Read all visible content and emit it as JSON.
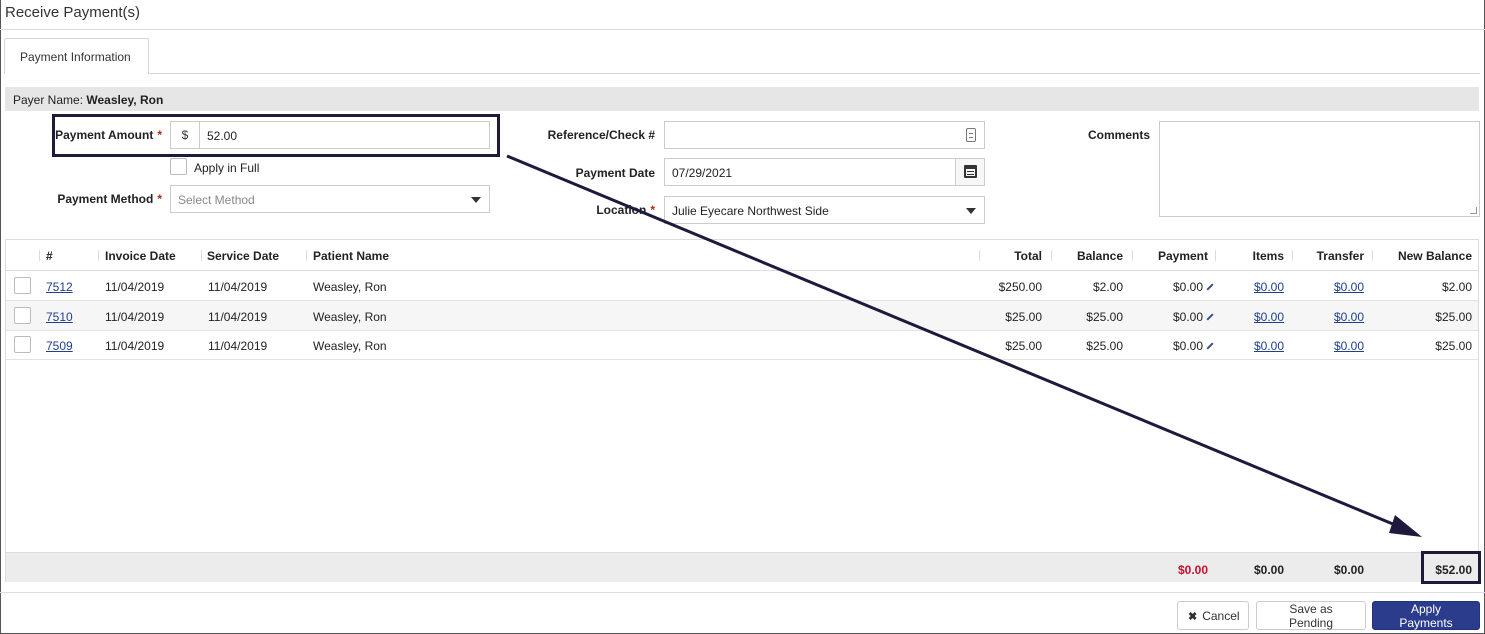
{
  "window": {
    "title": "Receive Payment(s)"
  },
  "tabs": [
    {
      "label": "Payment Information"
    }
  ],
  "payer": {
    "label": "Payer Name:",
    "name": "Weasley, Ron"
  },
  "form": {
    "payment_amount": {
      "label": "Payment Amount",
      "currency": "$",
      "value": "52.00"
    },
    "apply_in_full": {
      "label": "Apply in Full",
      "checked": false
    },
    "payment_method": {
      "label": "Payment Method",
      "placeholder": "Select Method"
    },
    "reference": {
      "label": "Reference/Check #",
      "value": ""
    },
    "payment_date": {
      "label": "Payment Date",
      "value": "07/29/2021"
    },
    "location": {
      "label": "Location",
      "value": "Julie Eyecare Northwest Side"
    },
    "comments": {
      "label": "Comments",
      "value": ""
    },
    "required_marker": "*"
  },
  "table": {
    "columns": [
      "#",
      "Invoice Date",
      "Service Date",
      "Patient Name",
      "Total",
      "Balance",
      "Payment",
      "Items",
      "Transfer",
      "New Balance"
    ],
    "rows": [
      {
        "invoice": "7512",
        "invoice_date": "11/04/2019",
        "service_date": "11/04/2019",
        "patient": "Weasley, Ron",
        "total": "$250.00",
        "balance": "$2.00",
        "payment": "$0.00",
        "items": "$0.00",
        "transfer": "$0.00",
        "new_balance": "$2.00"
      },
      {
        "invoice": "7510",
        "invoice_date": "11/04/2019",
        "service_date": "11/04/2019",
        "patient": "Weasley, Ron",
        "total": "$25.00",
        "balance": "$25.00",
        "payment": "$0.00",
        "items": "$0.00",
        "transfer": "$0.00",
        "new_balance": "$25.00"
      },
      {
        "invoice": "7509",
        "invoice_date": "11/04/2019",
        "service_date": "11/04/2019",
        "patient": "Weasley, Ron",
        "total": "$25.00",
        "balance": "$25.00",
        "payment": "$0.00",
        "items": "$0.00",
        "transfer": "$0.00",
        "new_balance": "$25.00"
      }
    ],
    "footer": {
      "payment": "$0.00",
      "items": "$0.00",
      "transfer": "$0.00",
      "new_balance": "$52.00"
    }
  },
  "buttons": {
    "cancel": "Cancel",
    "save_pending": "Save as Pending",
    "apply": "Apply Payments"
  },
  "colors": {
    "primary": "#2c3c8c",
    "link": "#1f3f8f",
    "required": "#b3261e",
    "negative": "#c8102e",
    "annotation": "#1d1a3c"
  },
  "icons": [
    "reference-lookup-icon",
    "calendar-icon",
    "dropdown-caret-icon",
    "edit-pencil-icon",
    "close-icon",
    "resize-grip-icon",
    "annotation-arrow"
  ]
}
